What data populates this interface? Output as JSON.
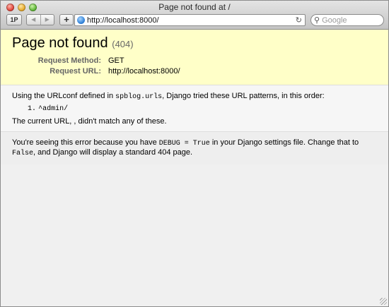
{
  "window": {
    "title": "Page not found at /"
  },
  "toolbar": {
    "pp_label": "1P",
    "back_glyph": "◀",
    "forward_glyph": "▶",
    "add_glyph": "+",
    "address": "http://localhost:8000/",
    "reload_glyph": "↻",
    "search_placeholder": "Google"
  },
  "error": {
    "title": "Page not found",
    "code": "(404)",
    "request_method_label": "Request Method:",
    "request_method": "GET",
    "request_url_label": "Request URL:",
    "request_url": "http://localhost:8000/"
  },
  "info": {
    "text_1": "Using the URLconf defined in ",
    "urlconf": "spblog.urls",
    "text_2": ", Django tried these URL patterns, in this order:",
    "pattern_num": "1.",
    "pattern": "^admin/",
    "current_url": "The current URL, , didn't match any of these."
  },
  "explanation": {
    "text_1": "You're seeing this error because you have ",
    "debug_code": "DEBUG = True",
    "text_2": " in your Django settings file. Change that to ",
    "false_code": "False",
    "text_3": ", and Django will display a standard 404 page."
  },
  "colors": {
    "summary_bg": "#ffffc8",
    "info_bg": "#f6f6f6",
    "page_bg": "#eeeeee"
  }
}
